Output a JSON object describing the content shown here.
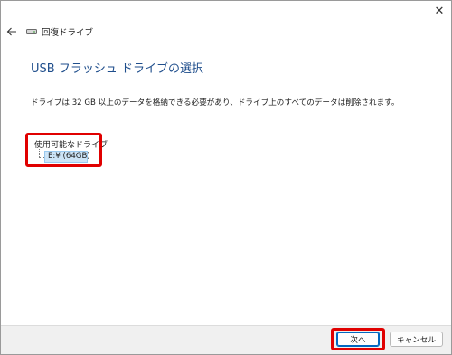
{
  "window": {
    "title": "回復ドライブ",
    "close_glyph": "✕"
  },
  "content": {
    "heading": "USB フラッシュ ドライブの選択",
    "description": "ドライブは 32 GB 以上のデータを格納できる必要があり、ドライブ上のすべてのデータは削除されます。",
    "available_drives_label": "使用可能なドライブ",
    "drives": [
      {
        "label": "E:¥ (64GB)",
        "selected": true
      }
    ]
  },
  "footer": {
    "next_label": "次へ",
    "cancel_label": "キャンセル"
  },
  "colors": {
    "heading": "#1f4e8c",
    "highlight": "#e00000",
    "selection": "#cce4f7",
    "accent": "#0067c0"
  },
  "icons": {
    "back": "back-arrow-icon",
    "title": "drive-icon",
    "close": "close-icon"
  }
}
